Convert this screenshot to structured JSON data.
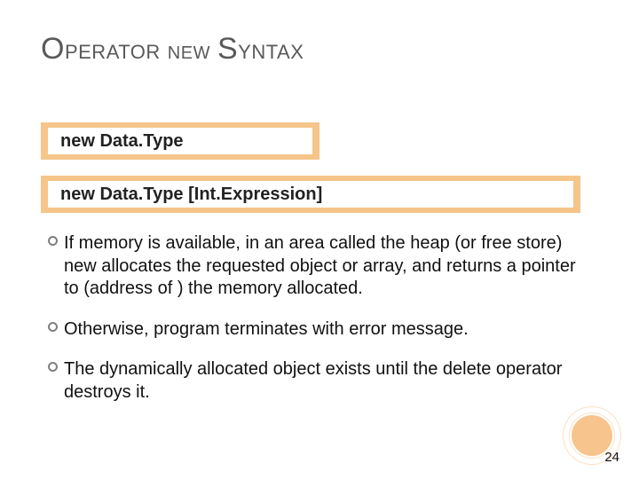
{
  "title": {
    "part1_drop": "O",
    "part1_rest": "PERATOR",
    "part2": "NEW",
    "part3_drop": "S",
    "part3_rest": "YNTAX"
  },
  "syntax_boxes": [
    "new   Data.Type",
    "new   Data.Type  [Int.Expression]"
  ],
  "bullets": [
    "If memory is available, in an area called the heap (or free store) new allocates the requested object or array, and returns a pointer to (address of ) the memory allocated.",
    "Otherwise, program terminates with error message.",
    "The dynamically allocated object exists until the delete operator destroys it."
  ],
  "page_number": "24",
  "colors": {
    "box_border": "#f5c58a",
    "accent_circle": "#f6c48c",
    "title_color": "#595959"
  }
}
